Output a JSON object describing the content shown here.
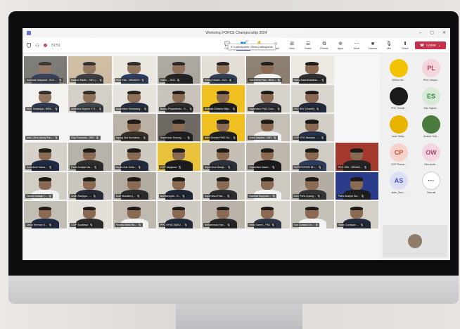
{
  "window": {
    "title": "Workshop FORCE Championship 2024",
    "controls": [
      "–",
      "▢",
      "✕"
    ]
  },
  "toolbar": {
    "timer": "51:51",
    "buttons": [
      {
        "icon": "chat-icon",
        "glyph": "💬",
        "label": "Chat"
      },
      {
        "icon": "people-icon",
        "glyph": "👥",
        "label": "People",
        "badge": "97"
      },
      {
        "icon": "raise-hand-icon",
        "glyph": "✋",
        "label": "Raise"
      },
      {
        "icon": "react-icon",
        "glyph": "☺",
        "label": "React"
      },
      {
        "icon": "view-icon",
        "glyph": "⊞",
        "label": "View"
      },
      {
        "icon": "notes-icon",
        "glyph": "☰",
        "label": "Notes"
      },
      {
        "icon": "rooms-icon",
        "glyph": "⧉",
        "label": "Rooms"
      },
      {
        "icon": "apps-icon",
        "glyph": "⊕",
        "label": "Apps"
      },
      {
        "icon": "more-icon",
        "glyph": "⋯",
        "label": "More"
      },
      {
        "icon": "camera-icon",
        "glyph": "■",
        "label": "Camera"
      },
      {
        "icon": "mic-icon",
        "glyph": "🎙",
        "label": "Mic"
      },
      {
        "icon": "share-icon",
        "glyph": "⬆",
        "label": "Share"
      }
    ],
    "leave_label": "Leave",
    "tooltip": "97 participants. Show participants"
  },
  "participants": [
    {
      "name": "Achmad Arsiyandi - SVC ...",
      "bg": "#6d6a64",
      "shirt": "#1d2b46"
    },
    {
      "name": "Badrun Radhi - SBY (...",
      "bg": "#c9b79a",
      "shirt": "#2a2a30"
    },
    {
      "name": "PDC Palu - BRANCH",
      "bg": "#e9e6df",
      "shirt": "#1e2e56"
    },
    {
      "name": "Yuhin ... SVC",
      "bg": "#a8a49c",
      "shirt": "#1a1a1a"
    },
    {
      "name": "Devvy Novari - SVC",
      "bg": "#e2ded6",
      "shirt": "#2d3a55"
    },
    {
      "name": "Sekretaris Palu - BKA...",
      "bg": "#8c7f70",
      "shirt": "#f1f1f1"
    },
    {
      "name": "Harry Swaramadana ...",
      "bg": "#ece9e3",
      "shirt": "#2f2f2f"
    },
    {
      "name": "",
      "bg": "#f7f7f7",
      "shirt": "#f7f7f7",
      "empty": true
    },
    {
      "name": "PDC Surabaya - BRA...",
      "bg": "#f2f1ee",
      "shirt": "#1e2a44"
    },
    {
      "name": "Antonius Suyono Y S...",
      "bg": "#d2cdc4",
      "shirt": "#353a44"
    },
    {
      "name": "Supervisor Semarang...",
      "bg": "#e5e2dc",
      "shirt": "#1f2a40"
    },
    {
      "name": "Benny Priyambodo - S...",
      "bg": "#c7c3bb",
      "shirt": "#2b2b2b"
    },
    {
      "name": "Ananda Dharma Wija...",
      "bg": "#f0c020",
      "shirt": "#1c1c1c"
    },
    {
      "name": "Supervisor PMC Sum...",
      "bg": "#d8d4cc",
      "shirt": "#2c2c34"
    },
    {
      "name": "PSC SBY (Gareth)",
      "bg": "#d9d6d0",
      "shirt": "#20283c"
    },
    {
      "name": "",
      "bg": "#f7f7f7",
      "shirt": "#f7f7f7",
      "empty": true
    },
    {
      "name": "Adm_Serv Ujung Pan...",
      "bg": "#f4f4f2",
      "shirt": "#f4f4f2",
      "empty": true
    },
    {
      "name": "Edy Purwanto - SBY",
      "bg": "#f4f4f2",
      "shirt": "#f4f4f2",
      "empty": true
    },
    {
      "name": "Agung Dwi Kurniawa...",
      "bg": "#b9b2a5",
      "shirt": "#3a2f28"
    },
    {
      "name": "Supervisor Sorong - ...",
      "bg": "#6e6a63",
      "shirt": "#1d1d22"
    },
    {
      "name": "Adm Service PMC Su...",
      "bg": "#f0c020",
      "shirt": "#1f1f1f"
    },
    {
      "name": "Aries Saputra - SBY",
      "bg": "#c6c0b6",
      "shirt": "#f0f0f0"
    },
    {
      "name": "COP GTO Manado - ...",
      "bg": "#d3cfc7",
      "shirt": "#24324a"
    },
    {
      "name": "",
      "bg": "#f7f7f7",
      "shirt": "#f7f7f7",
      "empty": true
    },
    {
      "name": "Scheduler Mana...",
      "bg": "#d5d1ca",
      "shirt": "#1e2a44"
    },
    {
      "name": "Parts Analyst Ma...",
      "bg": "#b8b3aa",
      "shirt": "#2c2c2c"
    },
    {
      "name": "Boyko Ade Setia...",
      "bg": "#cfcac2",
      "shirt": "#202a3c"
    },
    {
      "name": "COP Jayapura",
      "bg": "#e7c23a",
      "shirt": "#1b1b1b"
    },
    {
      "name": "Supervisor Banja...",
      "bg": "#c4beb4",
      "shirt": "#2a2f3a"
    },
    {
      "name": "Supervisor Asam...",
      "bg": "#bdb7ad",
      "shirt": "#1a1a1a"
    },
    {
      "name": "SUPERVISOR BLI...",
      "bg": "#d0ccc4",
      "shirt": "#2c3b5a"
    },
    {
      "name": "PDC OBJ - BRANC...",
      "bg": "#a3382f",
      "shirt": "#242424"
    },
    {
      "name": "Jamal mutaqin (...",
      "bg": "#d2cec6",
      "shirt": "#f0f0f0"
    },
    {
      "name": "Andri Sanjaya - ...",
      "bg": "#cbc6bd",
      "shirt": "#252a36"
    },
    {
      "name": "Andi Muzakkir (...",
      "bg": "#b1aba1",
      "shirt": "#2a2a2a"
    },
    {
      "name": "Nurdiansyah - S...",
      "bg": "#d7d3cb",
      "shirt": "#1e2636"
    },
    {
      "name": "Supervisor Palu ...",
      "bg": "#c9c4bb",
      "shirt": "#2b2b30"
    },
    {
      "name": "Rahmat Supiyant...",
      "bg": "#cec9c0",
      "shirt": "#f2f2f2"
    },
    {
      "name": "Adm Parts Upang...",
      "bg": "#b4ada3",
      "shirt": "#333"
    },
    {
      "name": "Parts Analyst Sor...",
      "bg": "#2a3c8a",
      "shirt": "#1d1d1d"
    },
    {
      "name": "Dicky Herman S...",
      "bg": "#c3beb5",
      "shirt": "#1e2a44"
    },
    {
      "name": "COP Surabaya",
      "bg": "#e2dfd8",
      "shirt": "#2a2a2a"
    },
    {
      "name": "Rivaldo Aktar Ra...",
      "bg": "#bfb9af",
      "shirt": "#f1f1f1"
    },
    {
      "name": "PPC NFMC BANJ...",
      "bg": "#cfcbc3",
      "shirt": "#20283a"
    },
    {
      "name": "Mohammad Han...",
      "bg": "#b8b2a8",
      "shirt": "#262626"
    },
    {
      "name": "Henk Saerni - PBJ",
      "bg": "#d9d5cd",
      "shirt": "#2b3346"
    },
    {
      "name": "Sub Contact Ce...",
      "bg": "#c6c1b8",
      "shirt": "#f3f3f3"
    },
    {
      "name": "Victor Gunawan ...",
      "bg": "#d4d0c8",
      "shirt": "#22293a"
    }
  ],
  "roster": [
    {
      "name": "Bhimo Ge...",
      "initials": "",
      "bg": "#f2c200",
      "fg": "#222",
      "icon": "bulldozer-icon"
    },
    {
      "name": "PDC Likupa...",
      "initials": "PL",
      "bg": "#f3d6db",
      "fg": "#a4445a"
    },
    {
      "name": "PDC Temati...",
      "initials": "",
      "bg": "#1a1a1a",
      "fg": "#f2c200",
      "icon": "logo-icon"
    },
    {
      "name": "Edo Saputr...",
      "initials": "ES",
      "bg": "#d7ead8",
      "fg": "#2f7a3a"
    },
    {
      "name": "Iwan Setia...",
      "initials": "",
      "bg": "#e8b400",
      "fg": "#222",
      "icon": "photo-icon"
    },
    {
      "name": "Ananto Sub...",
      "initials": "",
      "bg": "#4a7a3d",
      "fg": "#fff",
      "icon": "photo-icon"
    },
    {
      "name": "COP Pomal...",
      "initials": "CP",
      "bg": "#f6d3c9",
      "fg": "#b4503a"
    },
    {
      "name": "Oke Andri ...",
      "initials": "OW",
      "bg": "#f3d6e2",
      "fg": "#a8456e"
    },
    {
      "name": "Adm_Serv ...",
      "initials": "AS",
      "bg": "#dcdff3",
      "fg": "#4b53bc"
    },
    {
      "name": "View all",
      "initials": "···",
      "bg": "#ffffff",
      "fg": "#333"
    }
  ]
}
